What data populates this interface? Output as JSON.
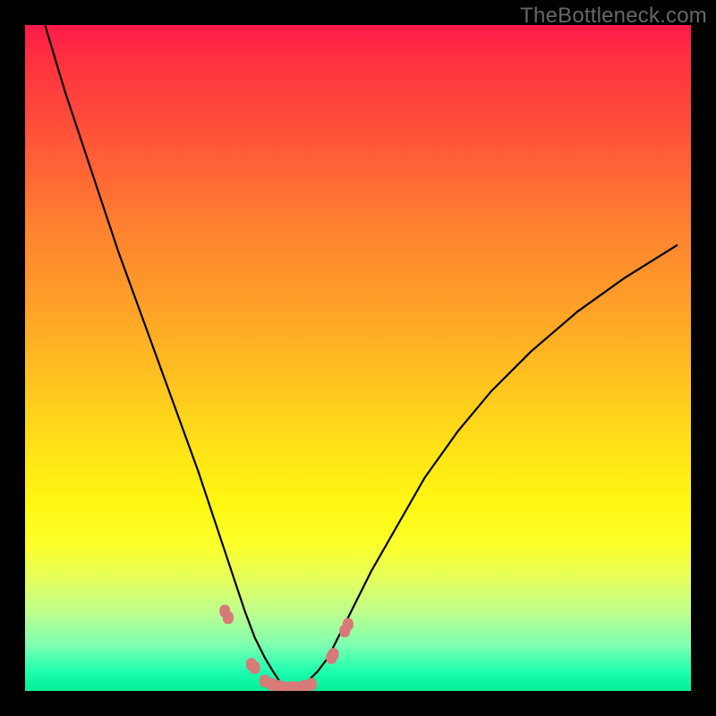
{
  "watermark_text": "TheBottleneck.com",
  "chart_data": {
    "type": "line",
    "title": "",
    "xlabel": "",
    "ylabel": "",
    "xlim": [
      0,
      100
    ],
    "ylim": [
      0,
      100
    ],
    "series": [
      {
        "name": "curve",
        "x": [
          3,
          6,
          10,
          14,
          18,
          22,
          26,
          29,
          31,
          33,
          34.5,
          36,
          37.2,
          38.2,
          39,
          40,
          41,
          42.5,
          44,
          45.5,
          47,
          49,
          52,
          56,
          60,
          65,
          70,
          76,
          83,
          90,
          98
        ],
        "y": [
          100,
          90,
          78,
          66,
          55,
          44,
          33,
          24,
          18,
          12,
          8,
          5,
          3,
          1.5,
          0.8,
          0.5,
          0.8,
          1.5,
          3,
          5,
          8,
          12,
          18,
          25,
          32,
          39,
          45,
          51,
          57,
          62,
          67
        ]
      }
    ],
    "annotations": {
      "marker_cluster": {
        "note": "Pink markers near curve minimum (approximate)",
        "points": [
          {
            "x": 30,
            "y": 12
          },
          {
            "x": 30.5,
            "y": 11
          },
          {
            "x": 34,
            "y": 4
          },
          {
            "x": 34.5,
            "y": 3.5
          },
          {
            "x": 36,
            "y": 1.5
          },
          {
            "x": 37,
            "y": 1
          },
          {
            "x": 38,
            "y": 0.7
          },
          {
            "x": 39,
            "y": 0.5
          },
          {
            "x": 40,
            "y": 0.5
          },
          {
            "x": 41,
            "y": 0.5
          },
          {
            "x": 42,
            "y": 0.7
          },
          {
            "x": 43,
            "y": 1
          },
          {
            "x": 46,
            "y": 5
          },
          {
            "x": 46.3,
            "y": 5.5
          },
          {
            "x": 48,
            "y": 9
          },
          {
            "x": 48.5,
            "y": 10
          }
        ]
      }
    },
    "colors": {
      "curve": "#000000",
      "markers": "#d77a78",
      "background_top": "#ff1a4a",
      "background_bottom": "#00ef97",
      "frame": "#000000"
    }
  }
}
